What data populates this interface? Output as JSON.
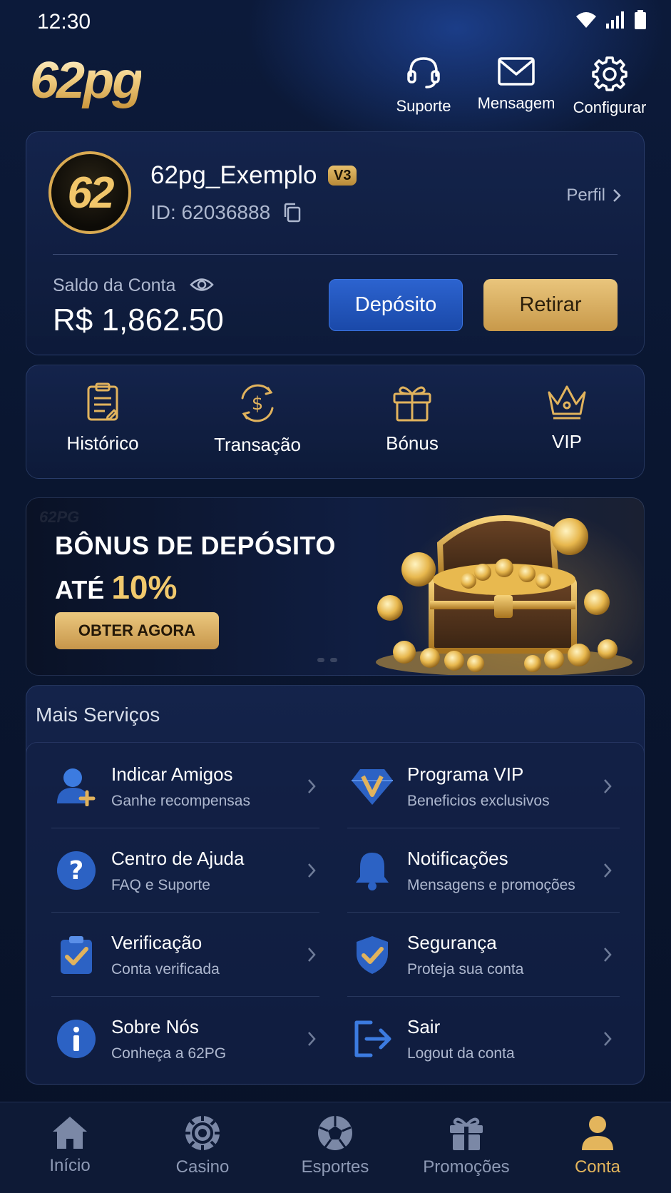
{
  "status_bar": {
    "time": "12:30"
  },
  "header": {
    "logo": "62pg",
    "actions": [
      {
        "label": "Suporte",
        "icon": "headset-icon"
      },
      {
        "label": "Mensagem",
        "icon": "mail-icon"
      },
      {
        "label": "Configurar",
        "icon": "gear-icon"
      }
    ]
  },
  "account": {
    "avatar_text": "62",
    "username": "62pg_Exemplo",
    "vip_level": "V3",
    "user_id": "ID: 62036888",
    "profile_link": "Perfil",
    "balance_label": "Saldo da Conta",
    "balance_value": "R$ 1,862.50",
    "deposit_label": "Depósito",
    "withdraw_label": "Retirar"
  },
  "quick_actions": [
    {
      "label": "Histórico",
      "icon": "clipboard-icon"
    },
    {
      "label": "Transação",
      "icon": "dollar-cycle-icon"
    },
    {
      "label": "Bónus",
      "icon": "gift-icon"
    },
    {
      "label": "VIP",
      "icon": "crown-icon"
    }
  ],
  "banner": {
    "watermark": "62PG",
    "title_line1": "BÔNUS DE DEPÓSITO",
    "title_line2_prefix": "ATÉ ",
    "title_line2_highlight": "10%",
    "cta": "OBTER AGORA",
    "image": "treasure-chest-icon"
  },
  "services": {
    "title": "Mais Serviços",
    "items": [
      {
        "title": "Indicar Amigos",
        "subtitle": "Ganhe recompensas",
        "icon": "add-user-icon"
      },
      {
        "title": "Programa VIP",
        "subtitle": "Beneficios exclusivos",
        "icon": "vip-diamond-icon"
      },
      {
        "title": "Centro de Ajuda",
        "subtitle": "FAQ e Suporte",
        "icon": "help-icon"
      },
      {
        "title": "Notificações",
        "subtitle": "Mensagens e promoções",
        "icon": "bell-icon"
      },
      {
        "title": "Verificação",
        "subtitle": "Conta verificada",
        "icon": "verified-clipboard-icon"
      },
      {
        "title": "Segurança",
        "subtitle": "Proteja sua conta",
        "icon": "shield-check-icon"
      },
      {
        "title": "Sobre Nós",
        "subtitle": "Conheça a 62PG",
        "icon": "info-icon"
      },
      {
        "title": "Sair",
        "subtitle": "Logout da conta",
        "icon": "logout-icon"
      }
    ]
  },
  "bottom_nav": [
    {
      "label": "Início",
      "icon": "home-icon",
      "active": false
    },
    {
      "label": "Casino",
      "icon": "casino-chip-icon",
      "active": false
    },
    {
      "label": "Esportes",
      "icon": "soccer-ball-icon",
      "active": false
    },
    {
      "label": "Promoções",
      "icon": "gift-icon",
      "active": false
    },
    {
      "label": "Conta",
      "icon": "user-icon",
      "active": true
    }
  ],
  "colors": {
    "accent_gold": "#e3b55c",
    "accent_blue": "#2c63cf",
    "background": "#0a1630"
  }
}
